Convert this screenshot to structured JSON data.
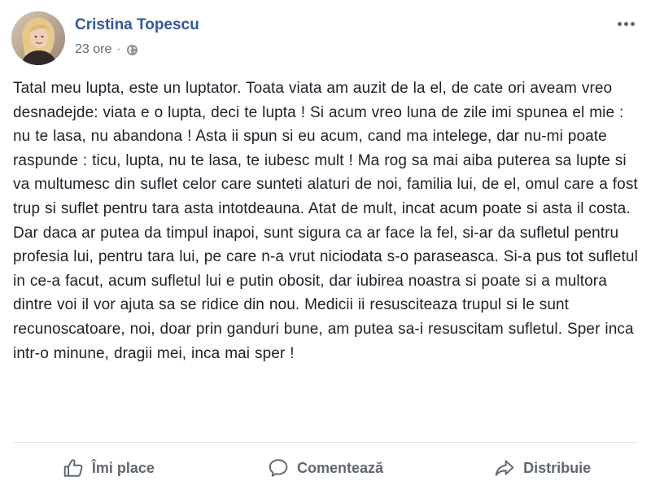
{
  "post": {
    "author": "Cristina Topescu",
    "time": "23 ore",
    "separator": "·",
    "privacy_icon": "globe-icon",
    "more_icon": "more-options-icon",
    "text": "Tatal meu lupta, este un luptator. Toata viata am auzit de la el, de cate ori aveam vreo desnadejde: viata e o lupta, deci te lupta ! Si acum vreo luna de zile imi spunea el mie : nu te lasa, nu abandona ! Asta ii spun si eu acum, cand ma intelege, dar nu-mi poate raspunde : ticu, lupta, nu te lasa, te iubesc mult ! Ma rog sa mai aiba puterea sa lupte si va multumesc din suflet celor care sunteti alaturi de noi, familia lui, de el, omul care a fost trup si suflet pentru tara asta intotdeauna. Atat de mult, incat acum poate si asta il costa. Dar daca ar putea da timpul inapoi, sunt sigura ca ar face la fel, si-ar da sufletul pentru profesia lui, pentru tara lui, pe care n-a vrut niciodata s-o paraseasca. Si-a pus tot sufletul in ce-a facut, acum sufletul lui e putin obosit, dar iubirea noastra si poate si a multora dintre voi il vor ajuta sa se ridice din nou. Medicii ii resusciteaza trupul si le sunt recunoscatoare, noi, doar prin ganduri bune, am putea sa-i resuscitam sufletul. Sper inca intr-o minune, dragii mei, inca mai sper !"
  },
  "actions": {
    "like": "Îmi place",
    "comment": "Comentează",
    "share": "Distribuie"
  },
  "colors": {
    "author_link": "#365899",
    "meta_text": "#616770",
    "action_text": "#606770",
    "divider": "#e5e5e5"
  }
}
